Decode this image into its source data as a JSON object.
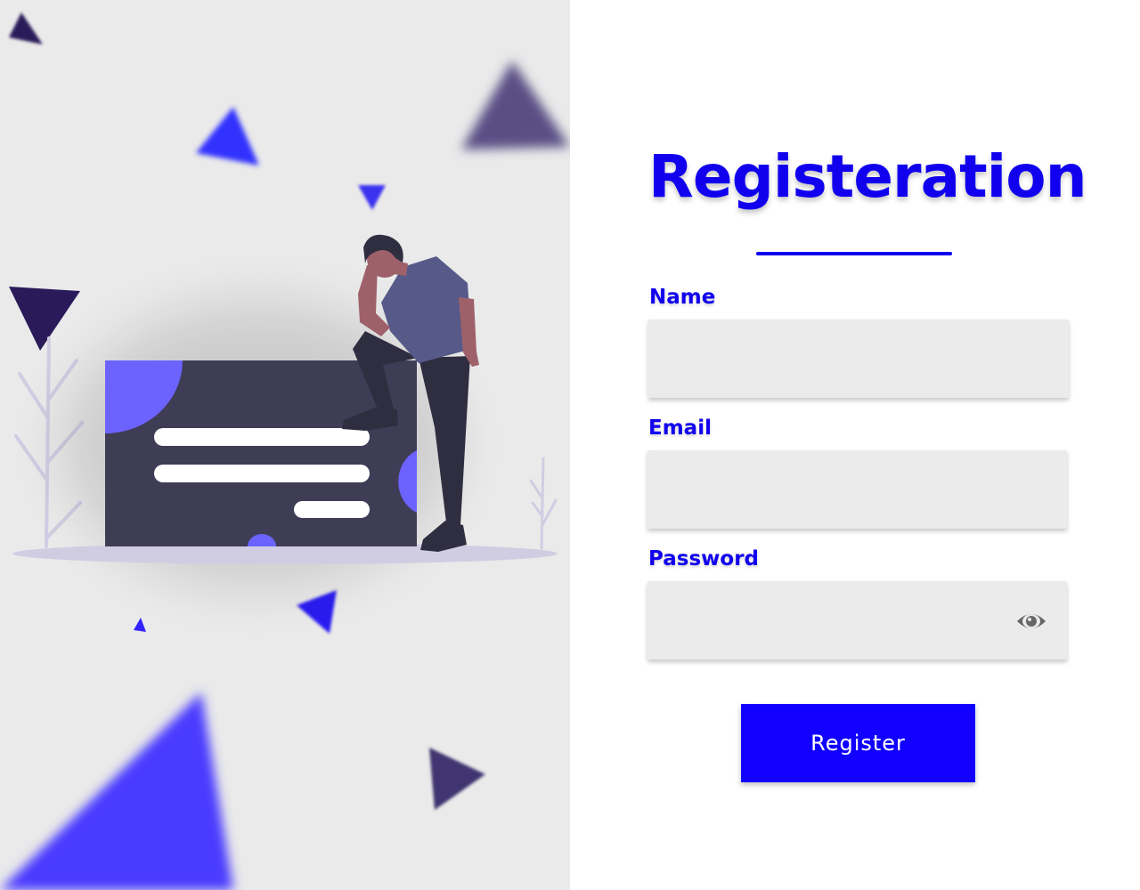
{
  "form": {
    "title": "Registeration",
    "name_label": "Name",
    "name_value": "",
    "email_label": "Email",
    "email_value": "",
    "password_label": "Password",
    "password_value": "",
    "password_toggle_icon": "eye-icon",
    "submit_label": "Register"
  },
  "illustration": {
    "description_icon": "person-thinking-over-form-card"
  },
  "colors": {
    "accent": "#1100ee",
    "button": "#1100ff",
    "input_bg": "#ebebeb",
    "left_panel_bg": "#eaeaea",
    "card": "#3f3d56",
    "card_accent": "#6c63ff"
  }
}
